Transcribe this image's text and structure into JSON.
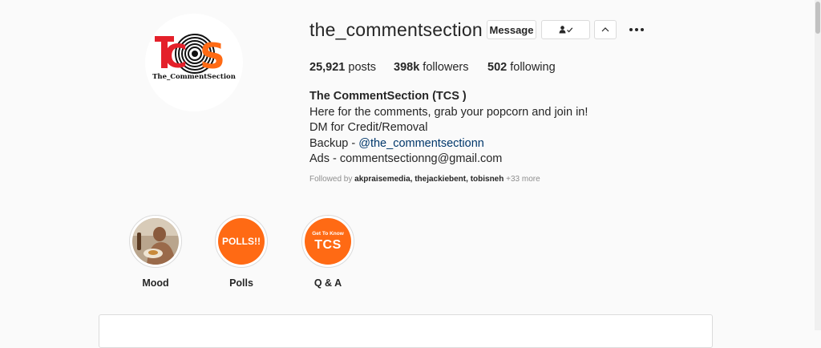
{
  "profile": {
    "username": "the_commentsection",
    "buttons": {
      "message": "Message"
    },
    "stats": {
      "posts_count": "25,921",
      "posts_label": "posts",
      "followers_count": "398k",
      "followers_label": "followers",
      "following_count": "502",
      "following_label": "following"
    },
    "bio": {
      "name": "The CommentSection (TCS )",
      "line1": "Here for the comments, grab your popcorn and join in!",
      "line2": "DM for Credit/Removal",
      "line3_prefix": "Backup - ",
      "line3_link": "@the_commentsectionn",
      "line4": "Ads - commentsectionng@gmail.com"
    },
    "followed_by": {
      "prefix": "Followed by ",
      "user1": "akpraisemedia",
      "user2": "thejackiebent",
      "user3": "tobisneh",
      "sep": ", ",
      "more": " +33 more"
    },
    "avatar": {
      "logo_text": "TCS",
      "logo_caption": "The_CommentSection"
    }
  },
  "highlights": [
    {
      "label": "Mood"
    },
    {
      "label": "Polls",
      "cover_text": "POLLS!!"
    },
    {
      "label": "Q & A",
      "cover_small": "Get To Know",
      "cover_big": "TCS"
    }
  ],
  "colors": {
    "accent_orange": "#ff6a14",
    "logo_red": "#e4202a",
    "link": "#00376b"
  },
  "icons": [
    "person-check-icon",
    "chevron-up-icon",
    "more-options-icon"
  ]
}
